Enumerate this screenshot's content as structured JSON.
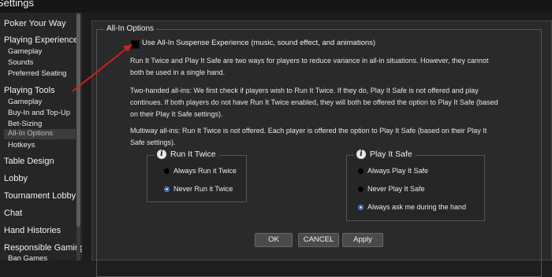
{
  "window": {
    "title": "Settings"
  },
  "sidebar": {
    "items": [
      {
        "label": "Poker Your Way"
      },
      {
        "label": "Playing Experience",
        "subitems": [
          "Gameplay",
          "Sounds",
          "Preferred Seating"
        ]
      },
      {
        "label": "Playing Tools",
        "subitems": [
          "Gameplay",
          "Buy-In and Top-Up",
          "Bet-Sizing",
          "All-In Options",
          "Hotkeys"
        ],
        "selected_subitem": "All-In Options"
      },
      {
        "label": "Table Design"
      },
      {
        "label": "Lobby"
      },
      {
        "label": "Tournament Lobby"
      },
      {
        "label": "Chat"
      },
      {
        "label": "Hand Histories"
      },
      {
        "label": "Responsible Gaming",
        "subitems": [
          "Ban Games"
        ]
      }
    ]
  },
  "allin": {
    "group_title": "All-In Options",
    "suspense_checkbox": {
      "label": "Use All-In Suspense Experience (music, sound effect, and animations)",
      "checked": true
    },
    "paragraphs": [
      "Run It Twice and Play It Safe are two ways for players to reduce variance in all-in situations. However, they cannot both be used in a single hand.",
      "Two-handed all-ins: We first check if players wish to Run It Twice. If they do, Play It Safe is not offered and play continues. If both players do not have Run It Twice enabled, they will both be offered the option to Play It Safe (based on their Play It Safe settings).",
      "Multiway all-ins: Run It Twice is not offered. Each player is offered the option to Play It Safe (based on their Play It Safe settings)."
    ],
    "run_it_twice": {
      "title": "Run It Twice",
      "options": [
        "Always Run it Twice",
        "Never Run it Twice"
      ],
      "selected": "Never Run it Twice"
    },
    "play_it_safe": {
      "title": "Play It Safe",
      "options": [
        "Always Play It Safe",
        "Never Play It Safe",
        "Always ask me during the hand"
      ],
      "selected": "Always ask me during the hand"
    }
  },
  "buttons": {
    "ok": "OK",
    "cancel": "CANCEL",
    "apply": "Apply"
  },
  "icons": {
    "info": "i"
  },
  "colors": {
    "accent_radio": "#0b3a8c",
    "arrow": "#d01f1f",
    "background": "#2a2a2a"
  }
}
